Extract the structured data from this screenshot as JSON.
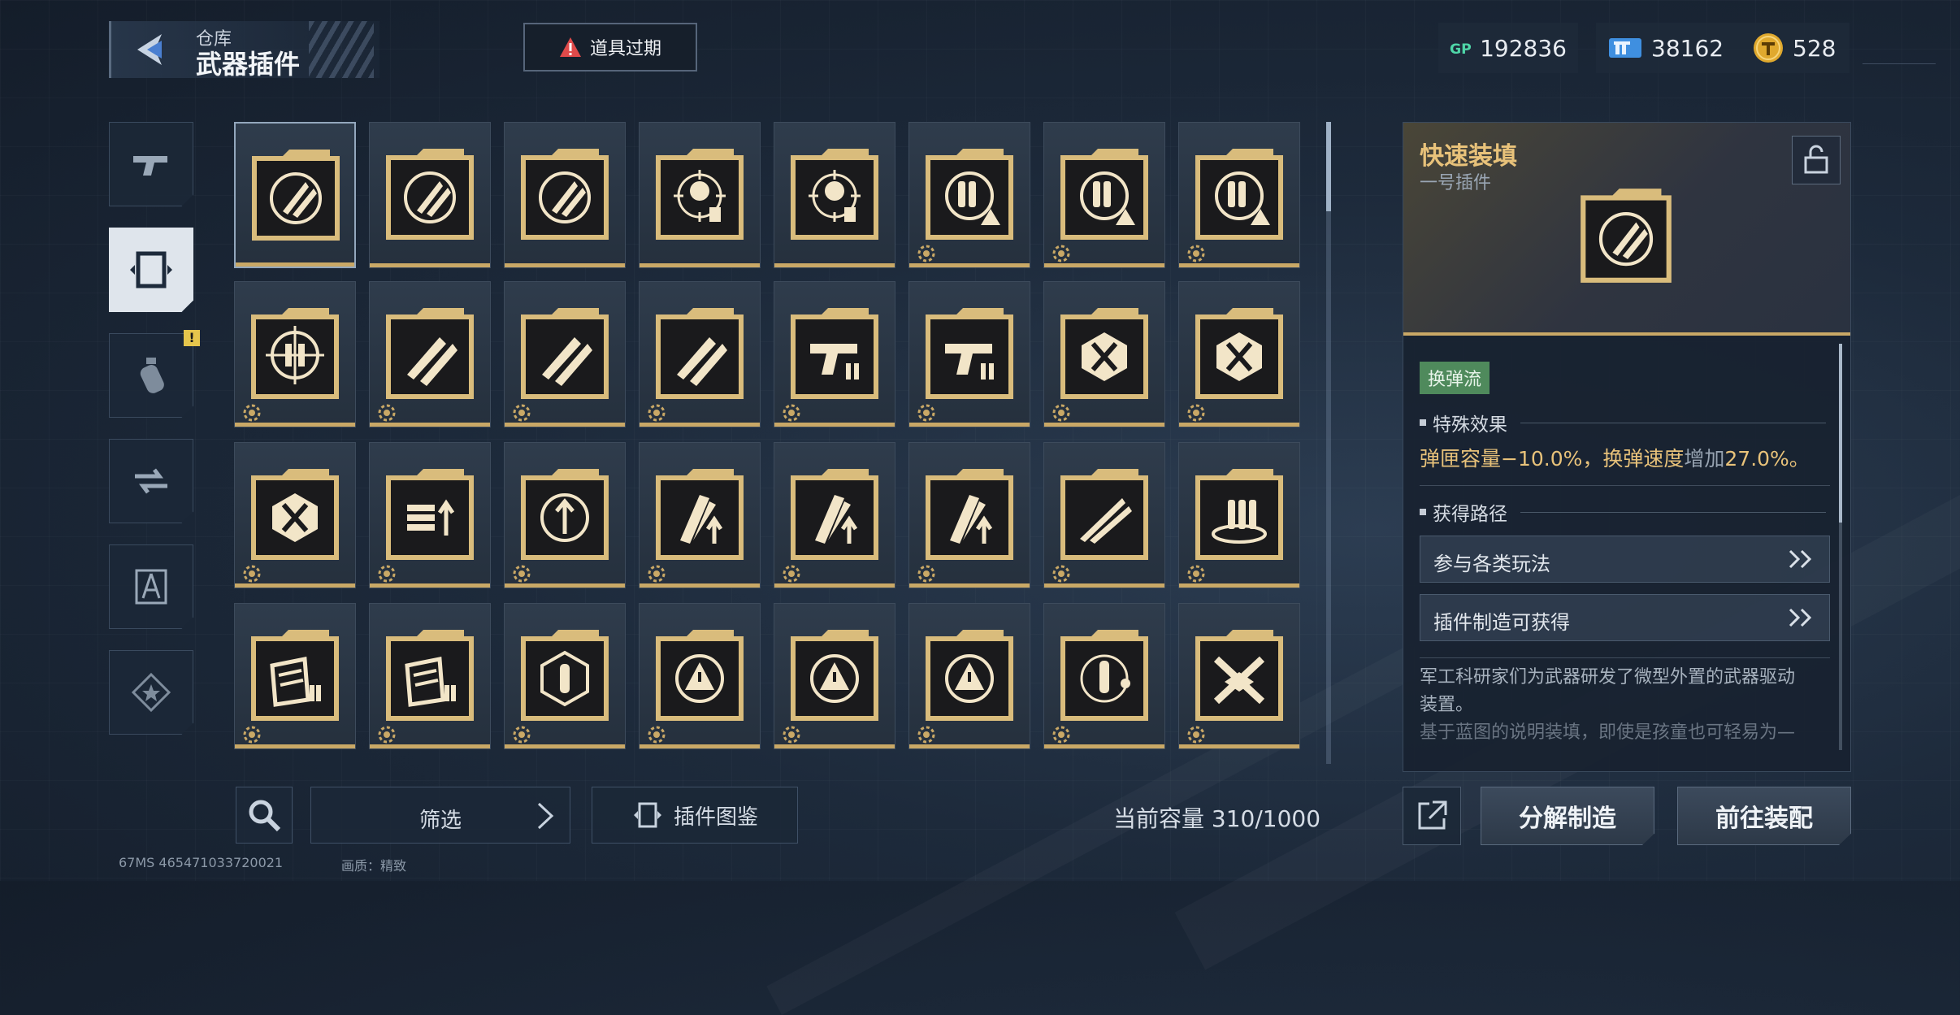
{
  "header": {
    "subtitle": "仓库",
    "title": "武器插件",
    "alert_label": "道具过期"
  },
  "currencies": [
    {
      "icon": "gp-icon",
      "value": "192836"
    },
    {
      "icon": "ticket-icon",
      "value": "38162"
    },
    {
      "icon": "coin-icon",
      "value": "528"
    }
  ],
  "categories": [
    {
      "icon": "pistol-icon",
      "active": false
    },
    {
      "icon": "plugin-frame-icon",
      "active": true
    },
    {
      "icon": "grenade-icon",
      "active": false,
      "badge": "!"
    },
    {
      "icon": "swap-gear-icon",
      "active": false
    },
    {
      "icon": "compass-icon",
      "active": false
    },
    {
      "icon": "star-emblem-icon",
      "active": false
    }
  ],
  "plugins": [
    [
      "reload-rocket-icon",
      "reload-rocket-icon",
      "reload-rocket-icon",
      "target-head-icon",
      "target-head-icon",
      "ammo-warning-icon",
      "ammo-warning-icon",
      "ammo-warning-icon"
    ],
    [
      "crosshair-ammo-icon",
      "double-bullet-icon",
      "double-bullet-icon",
      "double-bullet-icon",
      "pistol-ammo-icon",
      "pistol-ammo-icon",
      "x-shield-icon",
      "x-shield-icon"
    ],
    [
      "x-shield-icon",
      "ammo-up-icon",
      "scope-up-icon",
      "mag-up-icon",
      "mag-up-icon",
      "mag-up-icon",
      "triple-bullet-icon",
      "ammo-ring-icon"
    ],
    [
      "shield-ammo-icon",
      "shield-ammo-icon",
      "hex-bullet-icon",
      "cycle-warning-icon",
      "cycle-warning-icon",
      "cycle-warning-icon",
      "bullet-orbit-icon",
      "cross-swords-icon"
    ]
  ],
  "bottom": {
    "filter_label": "筛选",
    "atlas_label": "插件图鉴",
    "capacity": "当前容量 310/1000"
  },
  "footer": {
    "info": "67MS  465471033720021",
    "quality": "画质：精致"
  },
  "detail": {
    "title": "快速装填",
    "subtitle": "一号插件",
    "tag": "换弹流",
    "effect_heading": "特殊效果",
    "effect_part1": "弹匣容量−10.0%，换弹速度",
    "effect_part2": "增加",
    "effect_part3": "27.0%。",
    "source_heading": "获得路径",
    "routes": [
      "参与各类玩法",
      "插件制造可获得"
    ],
    "desc_line1": "军工科研家们为武器研发了微型外置的武器驱动",
    "desc_line2": "装置。",
    "desc_line3": "基于蓝图的说明装填，即使是孩童也可轻易为—"
  },
  "actions": {
    "dismantle": "分解制造",
    "equip": "前往装配"
  },
  "colors": {
    "gold": "#c9a866",
    "accent_text": "#e8c27a",
    "tag_green": "#4f8a5c"
  }
}
